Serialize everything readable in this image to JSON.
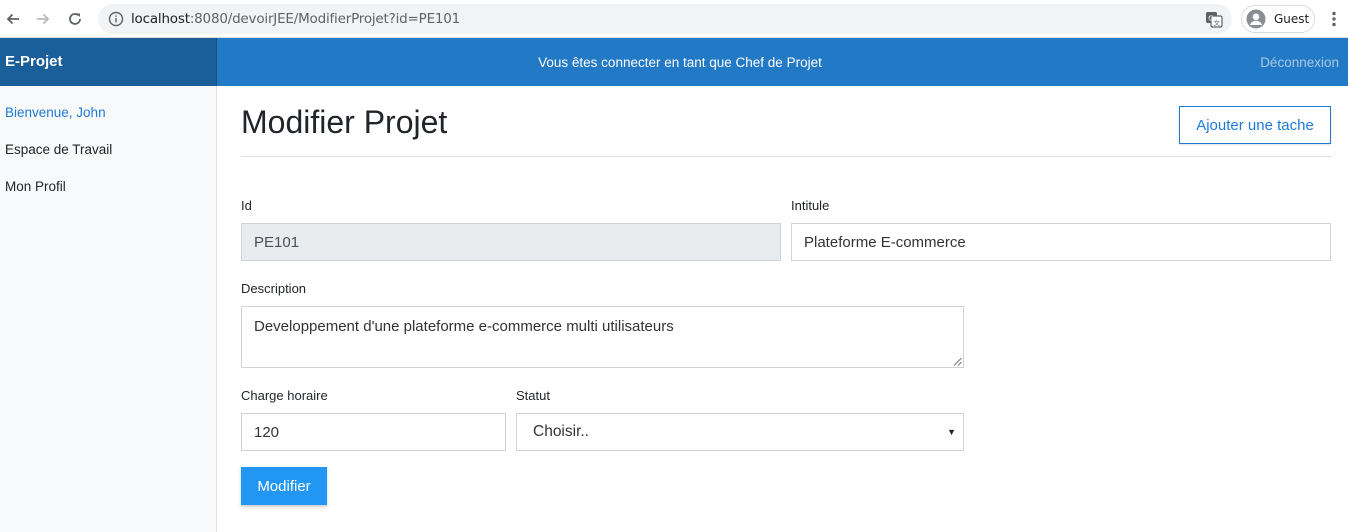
{
  "browser": {
    "url_host": "localhost",
    "url_rest": ":8080/devoirJEE/ModifierProjet?id=PE101",
    "profile_label": "Guest"
  },
  "header": {
    "brand": "E-Projet",
    "message": "Vous êtes connecter en tant que Chef de Projet",
    "logout_label": "Déconnexion"
  },
  "sidebar": {
    "items": [
      {
        "label": "Bienvenue, John",
        "active": true
      },
      {
        "label": "Espace de Travail"
      },
      {
        "label": "Mon Profil"
      }
    ]
  },
  "main": {
    "title": "Modifier Projet",
    "add_task_label": "Ajouter une tache",
    "form": {
      "id_label": "Id",
      "id_value": "PE101",
      "intitule_label": "Intitule",
      "intitule_value": "Plateforme E-commerce",
      "description_label": "Description",
      "description_value": "Developpement d'une plateforme e-commerce multi utilisateurs",
      "charge_label": "Charge horaire",
      "charge_value": "120",
      "statut_label": "Statut",
      "statut_selected": "Choisir..",
      "submit_label": "Modifier"
    }
  },
  "colors": {
    "brand_bar": "#1a5e9a",
    "top_bar": "#2279c5",
    "accent": "#1f7ad6",
    "submit": "#2196f3"
  }
}
